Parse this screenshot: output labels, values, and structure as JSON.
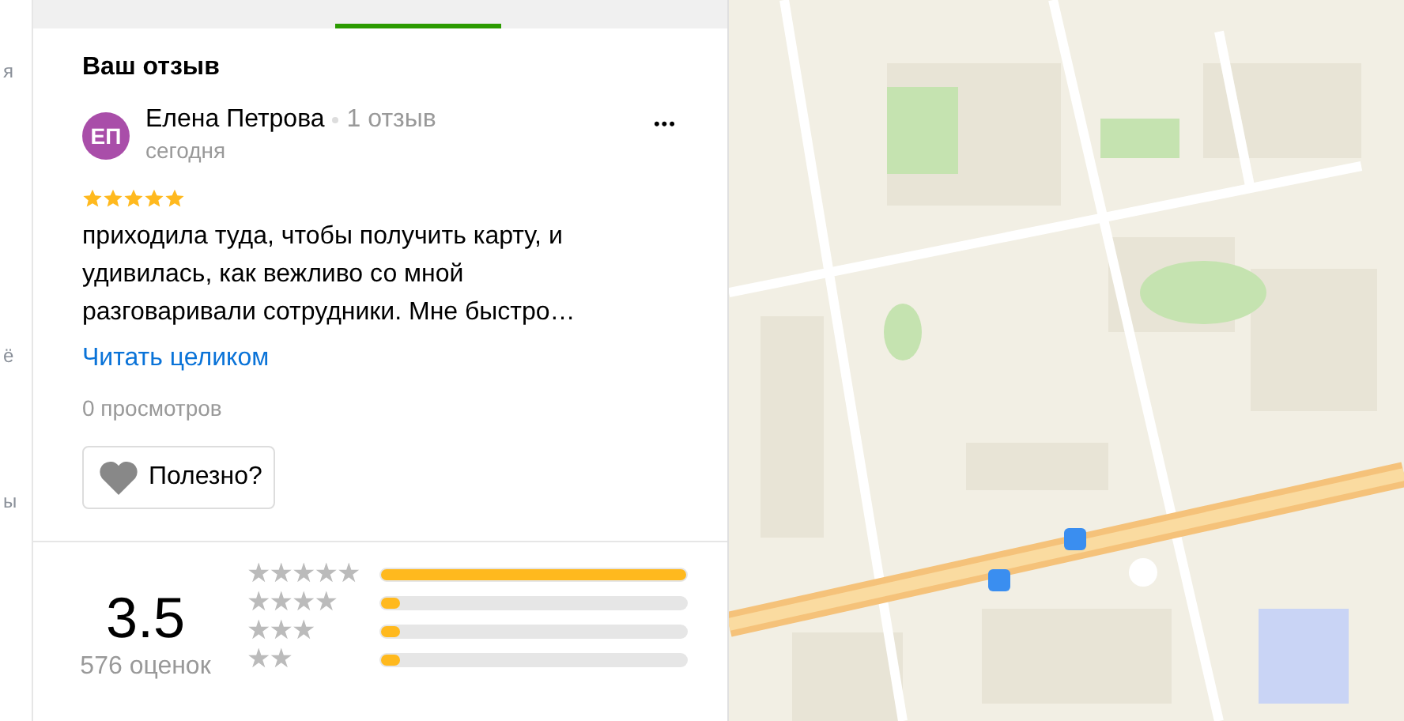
{
  "sidebar_fragments": [
    "я",
    "ё",
    "ы"
  ],
  "review": {
    "heading": "Ваш отзыв",
    "avatar_initials": "ЕП",
    "author": "Елена Петрова",
    "review_count": "1 отзыв",
    "date": "сегодня",
    "menu": "•••",
    "stars": 5,
    "text": "приходила туда, чтобы получить карту, и удивилась, как вежливо со мной разговаривали сотрудники. Мне быстро…",
    "read_more": "Читать целиком",
    "views": "0 просмотров",
    "helpful_button": "Полезно?"
  },
  "rating_summary": {
    "score": "3.5",
    "count": "576 оценок",
    "distribution": [
      {
        "label": "★★★★★",
        "level": 1.0
      },
      {
        "label": "★★★★",
        "level": 0.05
      },
      {
        "label": "★★★",
        "level": 0.04
      },
      {
        "label": "★★",
        "level": 0.06
      }
    ]
  }
}
